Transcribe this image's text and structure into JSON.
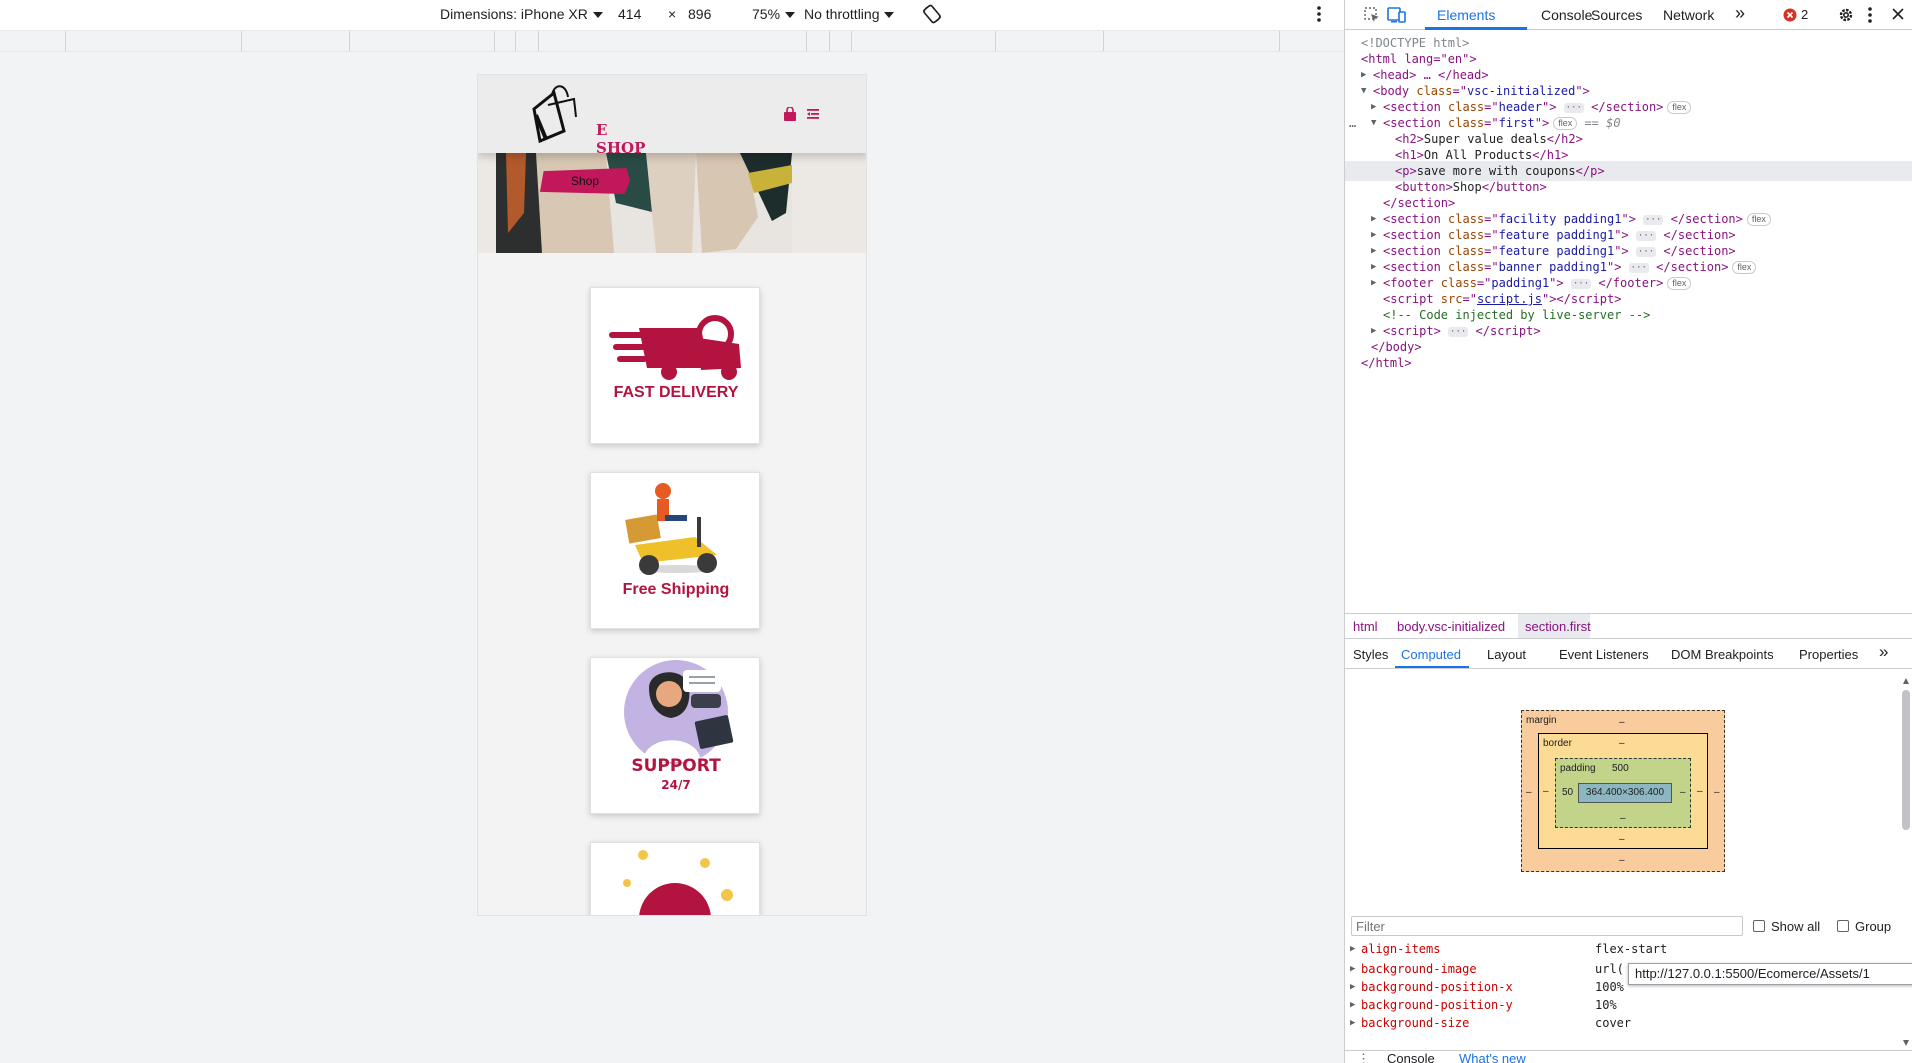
{
  "device_toolbar": {
    "dimensions_label": "Dimensions: iPhone XR",
    "width": "414",
    "times": "×",
    "height": "896",
    "zoom": "75%",
    "throttling": "No throttling"
  },
  "phone": {
    "logo_text": "E SHOP",
    "shop_button": "Shop",
    "cards": [
      {
        "label": "FAST DELIVERY"
      },
      {
        "label": "Free Shipping"
      },
      {
        "label": "SUPPORT",
        "sub": "24/7"
      }
    ]
  },
  "devtools": {
    "tabs": [
      "Elements",
      "Console",
      "Sources",
      "Network"
    ],
    "more_tabs": "»",
    "error_count": "2",
    "dom": {
      "doctype": "<!DOCTYPE html>",
      "html_open": "<html lang=\"en\">",
      "head": "<head> … </head>",
      "body_class": "vsc-initialized",
      "header_class": "header",
      "first_class": "first",
      "selected_marker": "== $0",
      "h2": "Super value deals",
      "h1": "On All Products",
      "p": "save more with coupons",
      "button": "Shop",
      "section_close": "</section>",
      "facility_class": "facility padding1",
      "feature_class": "feature padding1",
      "banner_class": "banner padding1",
      "footer_class": "padding1",
      "script_src": "script.js",
      "comment": "<!-- Code injected by live-server -->",
      "body_close": "</body>",
      "html_close": "</html>",
      "flex_badge": "flex"
    },
    "breadcrumbs": [
      "html",
      "body.vsc-initialized",
      "section.first"
    ],
    "sub_tabs": [
      "Styles",
      "Computed",
      "Layout",
      "Event Listeners",
      "DOM Breakpoints",
      "Properties"
    ],
    "box_model": {
      "margin_label": "margin",
      "border_label": "border",
      "padding_label": "padding",
      "padding_top": "500",
      "padding_left": "50",
      "content_size": "364.400×306.400",
      "dash": "–"
    },
    "filter_placeholder": "Filter",
    "show_all_label": "Show all",
    "group_label": "Group",
    "computed_props": [
      {
        "name": "align-items",
        "value": "flex-start"
      },
      {
        "name": "background-image",
        "value": "url("
      },
      {
        "name": "background-position-x",
        "value": "100%"
      },
      {
        "name": "background-position-y",
        "value": "10%"
      },
      {
        "name": "background-size",
        "value": "cover"
      }
    ],
    "url_tooltip": "http://127.0.0.1:5500/Ecomerce/Assets/1",
    "drawer_tabs": [
      "Console",
      "What's new"
    ]
  }
}
